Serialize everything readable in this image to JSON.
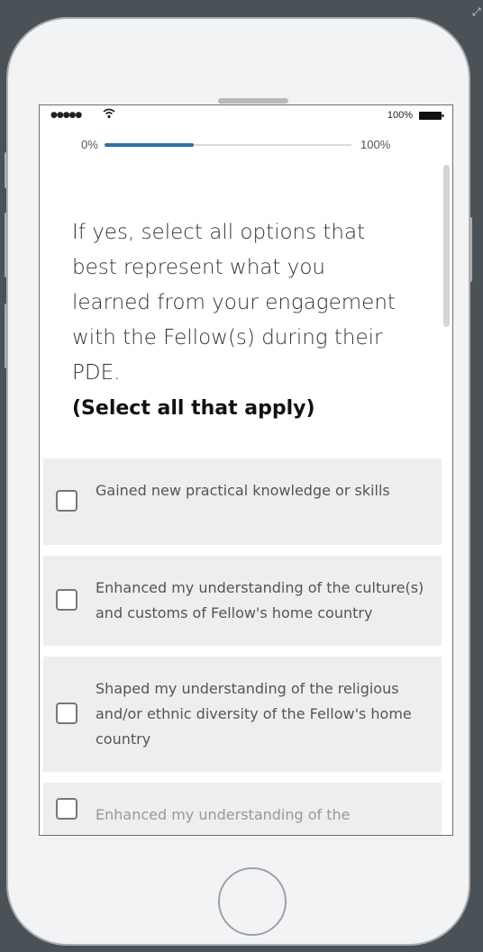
{
  "status_bar": {
    "signal": "●●●●●",
    "battery_percent": "100%"
  },
  "progress": {
    "start_label": "0%",
    "end_label": "100%",
    "value": 0.36
  },
  "question": {
    "text": "If yes, select all options that best represent what you learned from your engagement with the Fellow(s) during their PDE.",
    "instruction": "(Select all that apply)"
  },
  "options": [
    {
      "label": "Gained new practical knowledge or skills",
      "checked": false
    },
    {
      "label": "Enhanced my understanding of the culture(s) and customs of Fellow's home country",
      "checked": false
    },
    {
      "label": "Shaped my understanding of the religious and/or ethnic diversity of the Fellow's home country",
      "checked": false
    },
    {
      "label": "Enhanced my understanding of the",
      "checked": false
    }
  ],
  "colors": {
    "accent": "#2a6fb3",
    "option_bg": "#eeeeee",
    "frame_bg": "#4a5258"
  },
  "icons": {
    "wifi": "wifi-icon",
    "battery": "battery-icon",
    "checkbox": "checkbox-icon"
  }
}
